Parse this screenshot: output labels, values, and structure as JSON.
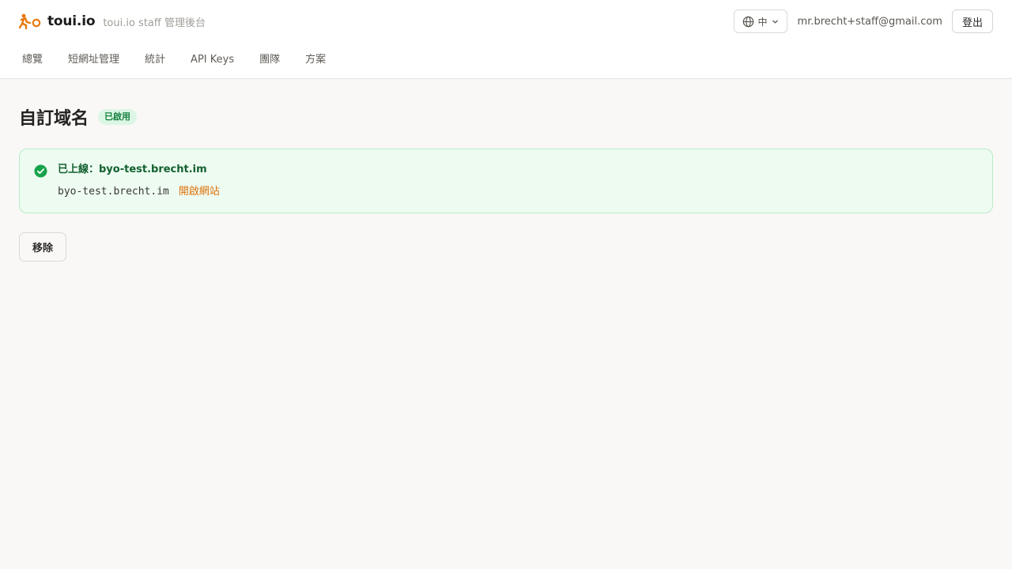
{
  "header": {
    "brand_name": "toui.io",
    "brand_subtitle": "toui.io staff 管理後台",
    "language_label": "中",
    "user_email": "mr.brecht+staff@gmail.com",
    "logout_label": "登出",
    "brand_color": "#e8780c"
  },
  "nav": {
    "items": [
      {
        "label": "總覽"
      },
      {
        "label": "短網址管理"
      },
      {
        "label": "統計"
      },
      {
        "label": "API Keys"
      },
      {
        "label": "團隊"
      },
      {
        "label": "方案"
      }
    ]
  },
  "page": {
    "title": "自訂域名",
    "status_badge": "已啟用",
    "status_color": "#16803d"
  },
  "alert": {
    "title": "已上線：byo-test.brecht.im",
    "domain": "byo-test.brecht.im",
    "open_link_label": "開啟網站",
    "icon": "check-circle-icon",
    "accent_color": "#17a34a"
  },
  "actions": {
    "remove_label": "移除"
  },
  "icons": {
    "logo": "running-person-logo",
    "language": "globe-icon",
    "dropdown": "chevron-down-icon"
  }
}
